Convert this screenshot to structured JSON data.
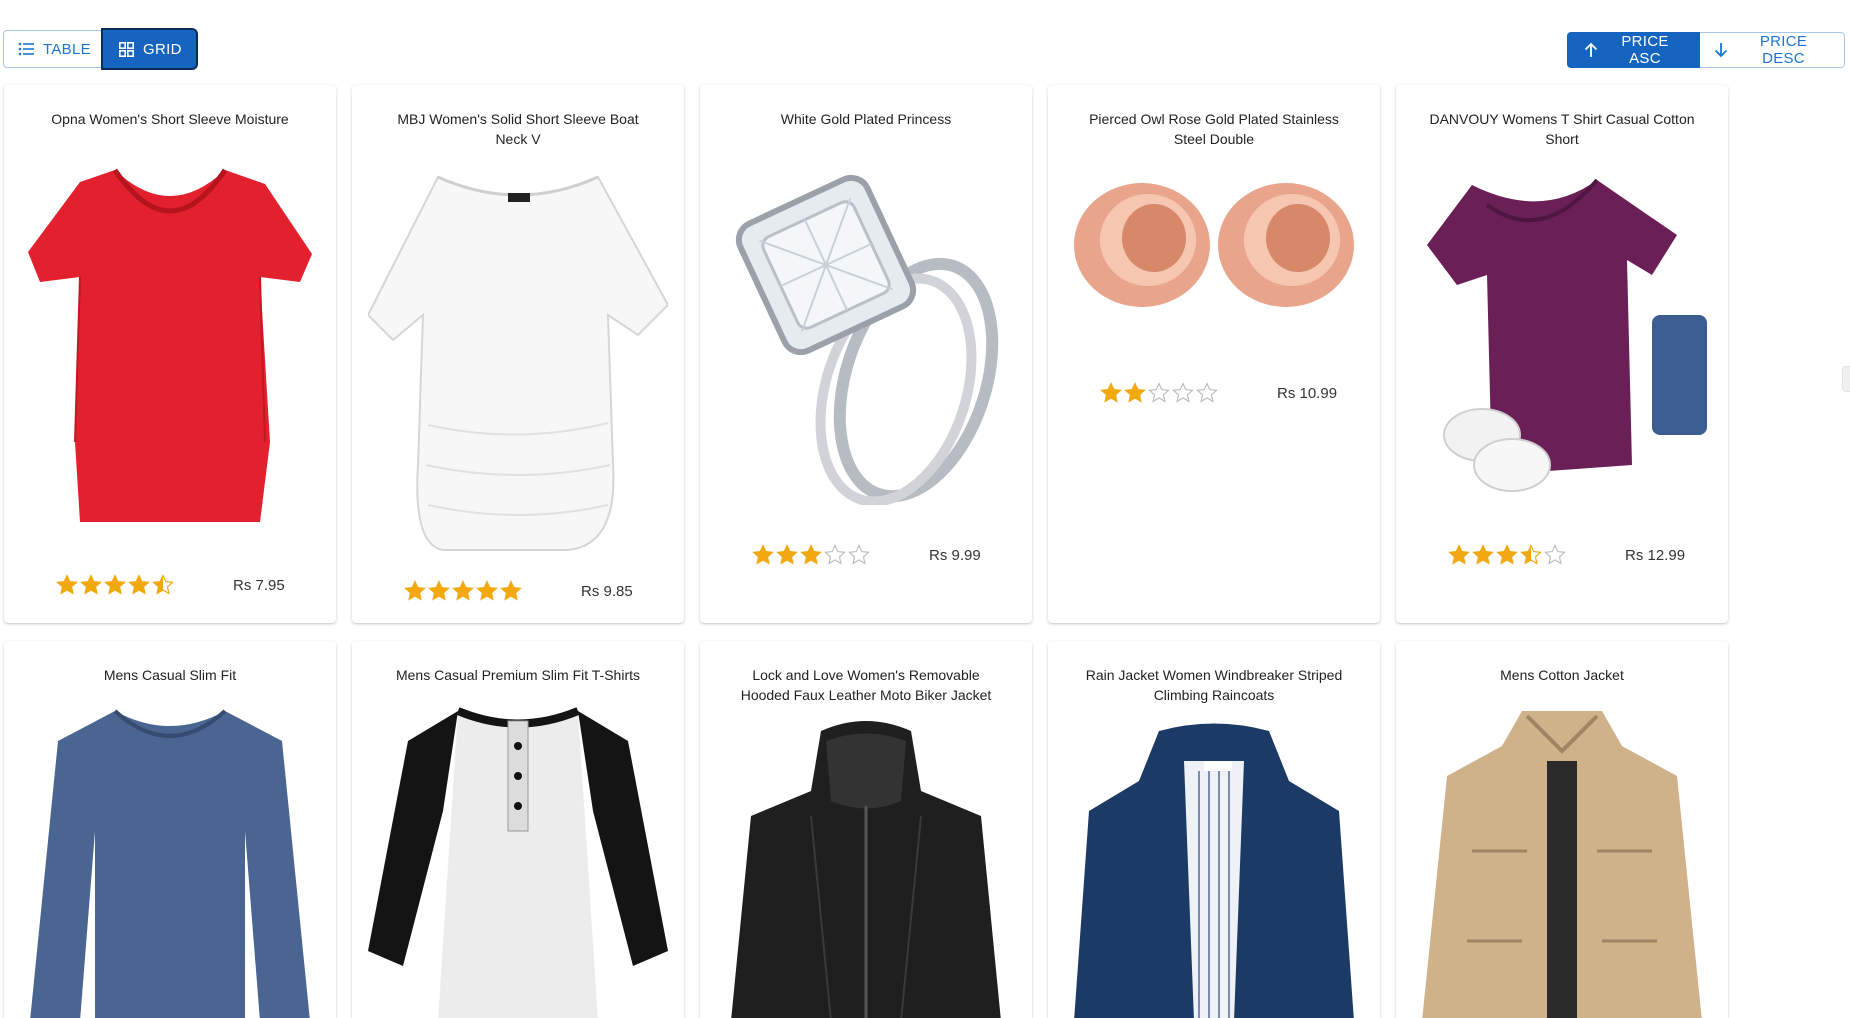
{
  "view_toggle": {
    "table_label": "TABLE",
    "grid_label": "GRID",
    "selected": "grid"
  },
  "sort_toggle": {
    "asc_label": "PRICE ASC",
    "desc_label": "PRICE DESC",
    "selected": "asc"
  },
  "colors": {
    "primary": "#1976d2",
    "primary_dark": "#1565c0",
    "star": "#f2a90f",
    "star_empty": "#bdbdbd"
  },
  "products": [
    {
      "title": "Opna Women's Short Sleeve Moisture",
      "rating": 4.5,
      "price": "Rs 7.95",
      "image": "red v-neck t-shirt"
    },
    {
      "title": "MBJ Women's Solid Short Sleeve Boat Neck V",
      "rating": 5,
      "price": "Rs 9.85",
      "image": "white boat-neck t-shirt"
    },
    {
      "title": "White Gold Plated Princess",
      "rating": 3,
      "price": "Rs 9.99",
      "image": "diamond ring set"
    },
    {
      "title": "Pierced Owl Rose Gold Plated Stainless Steel Double",
      "rating": 2,
      "price": "Rs 10.99",
      "image": "rose gold ear plugs"
    },
    {
      "title": "DANVOUY Womens T Shirt Casual Cotton Short",
      "rating": 3.5,
      "price": "Rs 12.99",
      "image": "purple be kind t-shirt"
    },
    {
      "title": "Mens Casual Slim Fit",
      "image": "blue long sleeve tee"
    },
    {
      "title": "Mens Casual Premium Slim Fit T-Shirts",
      "image": "raglan henley shirt"
    },
    {
      "title": "Lock and Love Women's Removable Hooded Faux Leather Moto Biker Jacket",
      "image": "black leather jacket"
    },
    {
      "title": "Rain Jacket Women Windbreaker Striped Climbing Raincoats",
      "image": "navy rain jacket"
    },
    {
      "title": "Mens Cotton Jacket",
      "image": "khaki cotton jacket"
    }
  ]
}
